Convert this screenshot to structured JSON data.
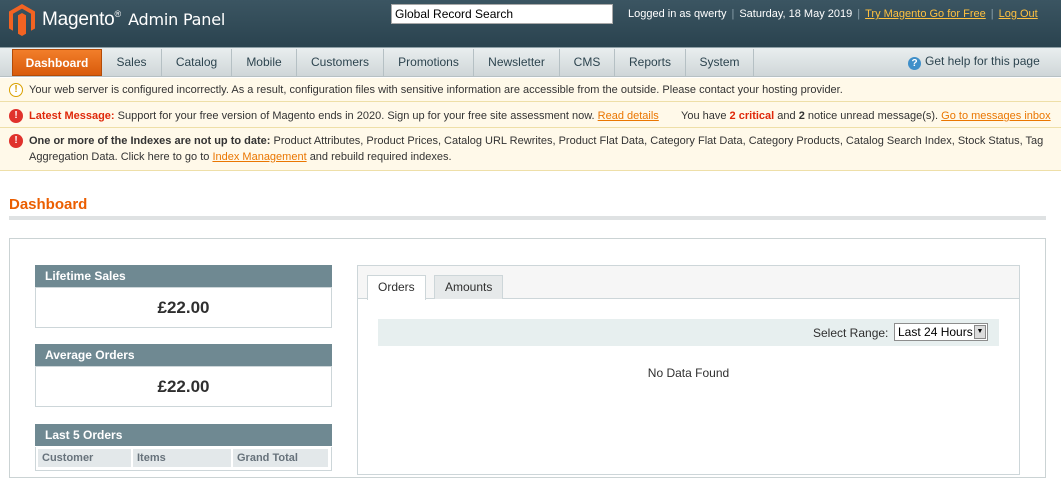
{
  "header": {
    "app_name": "Magento",
    "app_sub": "Admin Panel",
    "search_value": "Global Record Search",
    "logged_in": "Logged in as qwerty",
    "date": "Saturday, 18 May 2019",
    "try_link": "Try Magento Go for Free",
    "logout": "Log Out",
    "colors": {
      "bar": "#2f4a56",
      "link": "#ffc13f",
      "logo": "#f26322"
    }
  },
  "nav": {
    "items": [
      "Dashboard",
      "Sales",
      "Catalog",
      "Mobile",
      "Customers",
      "Promotions",
      "Newsletter",
      "CMS",
      "Reports",
      "System"
    ],
    "active": "Dashboard",
    "help": "Get help for this page",
    "colors": {
      "active": "#eb6512"
    }
  },
  "messages": {
    "m1": "Your web server is configured incorrectly. As a result, configuration files with sensitive information are accessible from the outside. Please contact your hosting provider.",
    "m2_label": "Latest Message:",
    "m2_text": "Support for your free version of Magento ends in 2020. Sign up for your free site assessment now.",
    "m2_link": "Read details",
    "m2_have": "You have",
    "m2_critical_count": "2",
    "m2_critical": "critical",
    "m2_and": "and",
    "m2_notice_count": "2",
    "m2_notice": "notice unread message(s).",
    "m2_inbox": "Go to messages inbox",
    "m3_label": "One or more of the Indexes are not up to date:",
    "m3_text": "Product Attributes, Product Prices, Catalog URL Rewrites, Product Flat Data, Category Flat Data, Category Products, Catalog Search Index, Stock Status, Tag Aggregation Data. Click here to go to",
    "m3_link": "Index Management",
    "m3_tail": "and rebuild required indexes."
  },
  "page": {
    "title": "Dashboard"
  },
  "stats": {
    "lifetime_label": "Lifetime Sales",
    "lifetime_value": "£22.00",
    "average_label": "Average Orders",
    "average_value": "£22.00",
    "last5_label": "Last 5 Orders",
    "columns": [
      "Customer",
      "Items",
      "Grand Total"
    ]
  },
  "chart": {
    "tabs": [
      "Orders",
      "Amounts"
    ],
    "active_tab": "Orders",
    "range_label": "Select Range:",
    "range_value": "Last 24 Hours",
    "empty": "No Data Found"
  }
}
